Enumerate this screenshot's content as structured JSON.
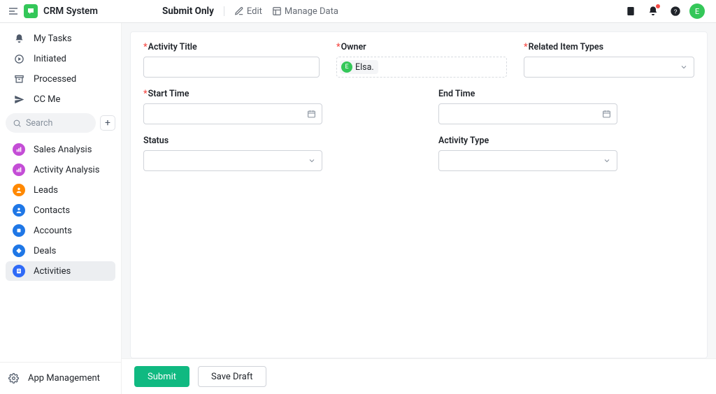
{
  "app": {
    "title": "CRM System",
    "logo_letter": ""
  },
  "header": {
    "page_title": "Submit Only",
    "edit_label": "Edit",
    "manage_data_label": "Manage Data",
    "avatar_letter": "E"
  },
  "sidebar": {
    "search_placeholder": "Search",
    "nav_top": [
      {
        "label": "My Tasks"
      },
      {
        "label": "Initiated"
      },
      {
        "label": "Processed"
      },
      {
        "label": "CC Me"
      }
    ],
    "nav_bottom": [
      {
        "label": "Sales Analysis"
      },
      {
        "label": "Activity Analysis"
      },
      {
        "label": "Leads"
      },
      {
        "label": "Contacts"
      },
      {
        "label": "Accounts"
      },
      {
        "label": "Deals"
      },
      {
        "label": "Activities"
      }
    ],
    "footer_label": "App Management"
  },
  "form": {
    "fields": {
      "activity_title": {
        "label": "Activity Title",
        "required": true
      },
      "owner": {
        "label": "Owner",
        "required": true,
        "value": "Elsa."
      },
      "related_item_types": {
        "label": "Related Item Types",
        "required": true
      },
      "start_time": {
        "label": "Start Time",
        "required": true
      },
      "end_time": {
        "label": "End Time",
        "required": false
      },
      "status": {
        "label": "Status",
        "required": false
      },
      "activity_type": {
        "label": "Activity Type",
        "required": false
      }
    },
    "owner_initial": "E"
  },
  "footer": {
    "submit_label": "Submit",
    "draft_label": "Save Draft"
  }
}
